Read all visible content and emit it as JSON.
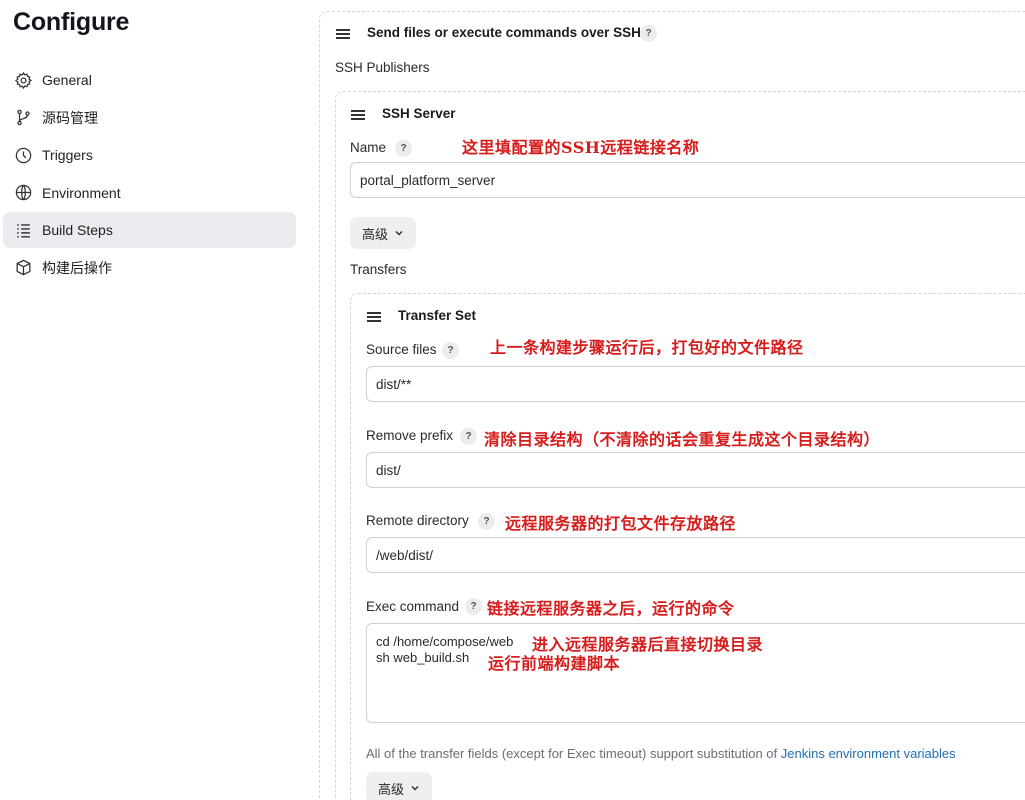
{
  "page": {
    "title": "Configure"
  },
  "sidebar": {
    "items": [
      {
        "label": "General",
        "icon": "gear-icon"
      },
      {
        "label": "源码管理",
        "icon": "branch-icon"
      },
      {
        "label": "Triggers",
        "icon": "clock-icon"
      },
      {
        "label": "Environment",
        "icon": "globe-icon"
      },
      {
        "label": "Build Steps",
        "icon": "list-icon",
        "active": true
      },
      {
        "label": "构建后操作",
        "icon": "cube-icon"
      }
    ]
  },
  "step": {
    "title": "Send files or execute commands over SSH",
    "help": "?",
    "publishers_label": "SSH Publishers"
  },
  "server": {
    "title": "SSH Server",
    "name_label": "Name",
    "name_value": "portal_platform_server",
    "advanced_label": "高级",
    "transfers_label": "Transfers"
  },
  "transfer": {
    "title": "Transfer Set",
    "source_label": "Source files",
    "source_value": "dist/**",
    "remove_label": "Remove prefix",
    "remove_value": "dist/",
    "remote_label": "Remote directory",
    "remote_value": "/web/dist/",
    "exec_label": "Exec command",
    "exec_line1": "cd /home/compose/web",
    "exec_line2": "sh web_build.sh",
    "note_prefix": "All of the transfer fields (except for Exec timeout) support substitution of ",
    "note_link": "Jenkins environment variables",
    "advanced_label": "高级"
  },
  "annotations": {
    "name": "这里填配置的SSH远程链接名称",
    "source": "上一条构建步骤运行后，打包好的文件路径",
    "remove": "清除目录结构（不清除的话会重复生成这个目录结构）",
    "remote": "远程服务器的打包文件存放路径",
    "exec": "链接远程服务器之后，运行的命令",
    "exec_line1": "进入远程服务器后直接切换目录",
    "exec_line2": "运行前端构建脚本"
  },
  "colors": {
    "annotation": "#d61d1d",
    "link": "#1f6fb5",
    "active_bg": "#ebebf0"
  }
}
